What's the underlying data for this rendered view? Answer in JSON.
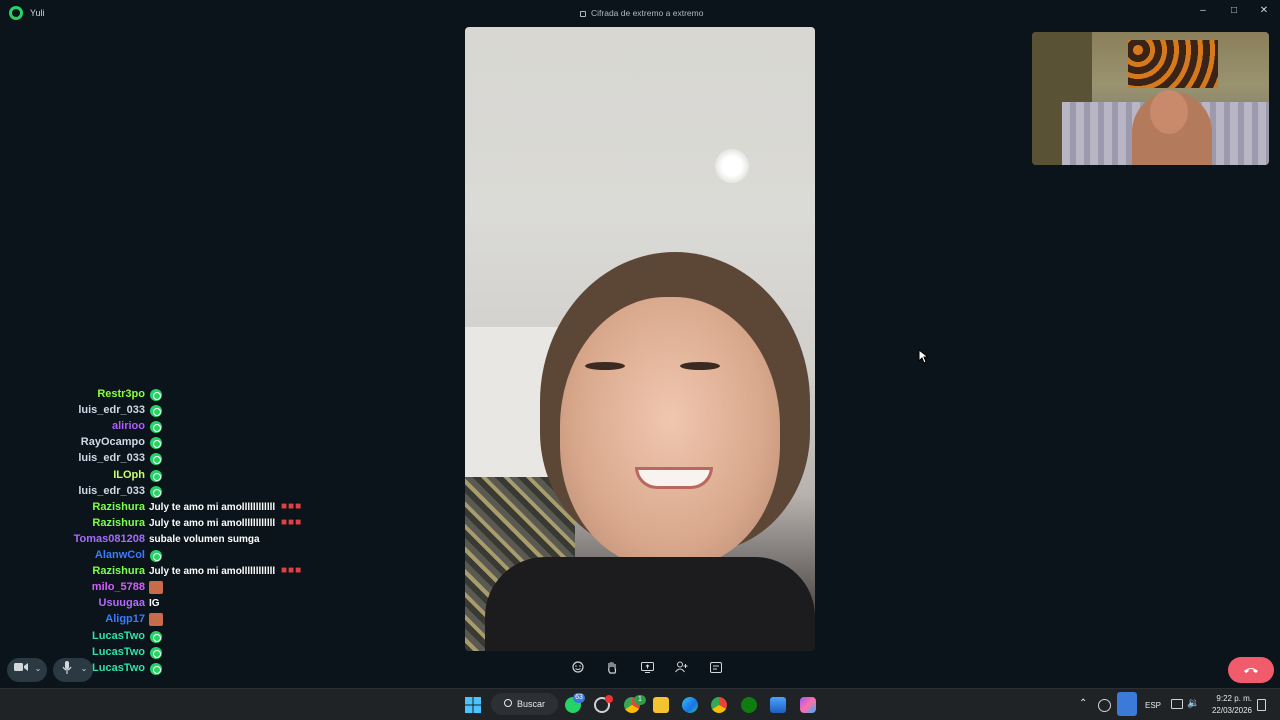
{
  "window": {
    "title": "Yuli",
    "encryption": "Cifrada de extremo a extremo"
  },
  "chat": [
    {
      "name": "Restr3po",
      "color": "#8dff3a",
      "type": "badge"
    },
    {
      "name": "luis_edr_033",
      "color": "#cfd8e6",
      "type": "badge"
    },
    {
      "name": "alirioo",
      "color": "#b05bff",
      "type": "badge"
    },
    {
      "name": "RayOcampo",
      "color": "#cfd8e6",
      "type": "badge"
    },
    {
      "name": "luis_edr_033",
      "color": "#cfd8e6",
      "type": "badge"
    },
    {
      "name": "ILOph",
      "color": "#c8ff6a",
      "type": "badge"
    },
    {
      "name": "luis_edr_033",
      "color": "#cfd8e6",
      "type": "badge"
    },
    {
      "name": "Razishura",
      "color": "#7cff4a",
      "type": "text",
      "text": "July te amo mi amollllllllllll"
    },
    {
      "name": "Razishura",
      "color": "#7cff4a",
      "type": "text",
      "text": "July te amo mi amollllllllllll"
    },
    {
      "name": "Tomas081208",
      "color": "#a66bff",
      "type": "text",
      "text": "subale volumen sumga"
    },
    {
      "name": "AlanwCol",
      "color": "#3a7bff",
      "type": "badge"
    },
    {
      "name": "Razishura",
      "color": "#7cff4a",
      "type": "text",
      "text": "July te amo mi amollllllllllll"
    },
    {
      "name": "milo_5788",
      "color": "#d65cff",
      "type": "image"
    },
    {
      "name": "Usuugaa",
      "color": "#b46bff",
      "type": "text",
      "text": "IG"
    },
    {
      "name": "Aligp17",
      "color": "#3a7bff",
      "type": "image"
    },
    {
      "name": "LucasTwo",
      "color": "#2fe0a8",
      "type": "badge"
    },
    {
      "name": "LucasTwo",
      "color": "#2fe0a8",
      "type": "badge"
    },
    {
      "name": "LucasTwo",
      "color": "#2fe0a8",
      "type": "badge"
    }
  ],
  "icons": {
    "camera": "camera-icon",
    "mic": "mic-icon",
    "emoji": "emoji-icon",
    "raise_hand": "raise-hand-icon",
    "share_screen": "share-screen-icon",
    "add_person": "add-person-icon",
    "chat": "chat-icon",
    "end_call": "end-call-icon"
  },
  "taskbar": {
    "search_label": "Buscar",
    "whatsapp_badge": "63",
    "chrome_badge": "1",
    "language": "ESP",
    "time": "9:22 p. m.",
    "date": "22/03/2026"
  },
  "colors": {
    "end_call": "#f15c6d",
    "background": "#0b141a",
    "accent": "#25d366"
  }
}
